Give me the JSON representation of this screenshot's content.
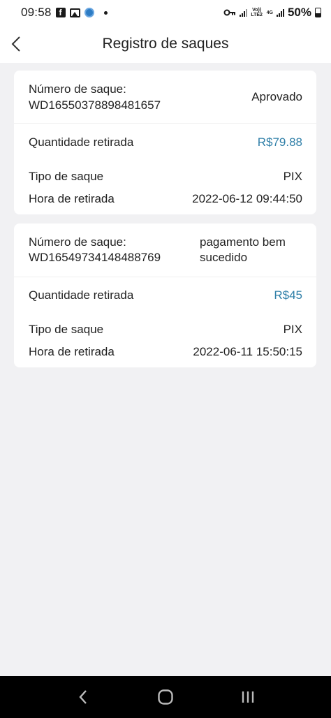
{
  "status_bar": {
    "time": "09:58",
    "battery": "50%",
    "volte_label": "Vo)) LTE2",
    "network_label": "4G"
  },
  "header": {
    "title": "Registro de saques"
  },
  "colors": {
    "amount": "#2f7fa8",
    "background": "#f1f1f3"
  },
  "withdrawals": [
    {
      "number_label": "Número de saque:",
      "number": "WD16550378898481657",
      "status": "Aprovado",
      "amount_label": "Quantidade retirada",
      "amount": "R$79.88",
      "type_label": "Tipo de saque",
      "type": "PIX",
      "time_label": "Hora de retirada",
      "time": "2022-06-12 09:44:50"
    },
    {
      "number_label": "Número de saque:",
      "number": "WD16549734148488769",
      "status_line1": "pagamento bem",
      "status_line2": "sucedido",
      "amount_label": "Quantidade retirada",
      "amount": "R$45",
      "type_label": "Tipo de saque",
      "type": "PIX",
      "time_label": "Hora de retirada",
      "time": "2022-06-11 15:50:15"
    }
  ],
  "nav": {
    "back_icon": "back-chevron-icon",
    "home_icon": "home-circle-icon",
    "recents_icon": "recents-bars-icon"
  }
}
